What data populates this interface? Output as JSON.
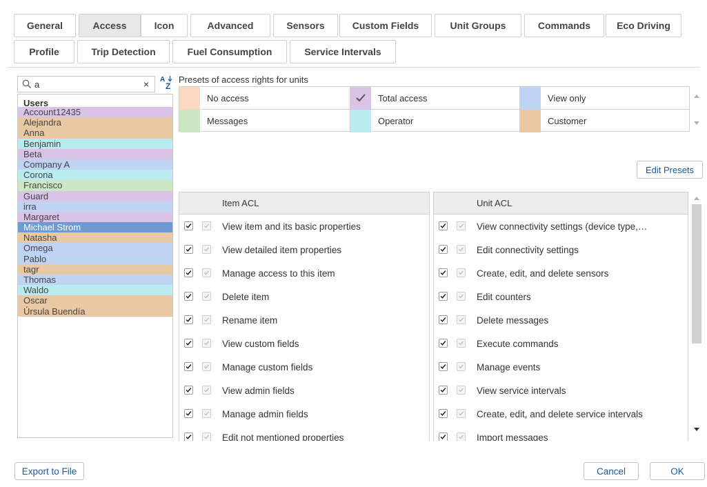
{
  "tabs": [
    {
      "label": "General"
    },
    {
      "label": "Access"
    },
    {
      "label": "Icon"
    },
    {
      "label": "Advanced"
    },
    {
      "label": "Sensors"
    },
    {
      "label": "Custom Fields"
    },
    {
      "label": "Unit Groups"
    },
    {
      "label": "Commands"
    },
    {
      "label": "Eco Driving"
    },
    {
      "label": "Profile"
    },
    {
      "label": "Trip Detection"
    },
    {
      "label": "Fuel Consumption"
    },
    {
      "label": "Service Intervals"
    }
  ],
  "active_tab": "Access",
  "search": {
    "value": "a",
    "icon": "search-icon",
    "clear": "×"
  },
  "users": {
    "header": "Users",
    "items": [
      {
        "name": "Account12435",
        "color": "#d9c3e6"
      },
      {
        "name": "Alejandra",
        "color": "#e9c9a4"
      },
      {
        "name": "Anna",
        "color": "#e9c9a4"
      },
      {
        "name": "Benjamin",
        "color": "#b8ecf0"
      },
      {
        "name": "Beta",
        "color": "#d9c3e6"
      },
      {
        "name": "Company A",
        "color": "#c0d3f2"
      },
      {
        "name": "Corona",
        "color": "#b8ecf0"
      },
      {
        "name": "Francisco",
        "color": "#cde6c4"
      },
      {
        "name": "Guard",
        "color": "#d9c3e6"
      },
      {
        "name": "irra",
        "color": "#c0d3f2"
      },
      {
        "name": "Margaret",
        "color": "#d9c3e6"
      },
      {
        "name": "Michael Strom",
        "color": "#6e9bd1",
        "selected": true
      },
      {
        "name": "Natasha",
        "color": "#e9c9a4"
      },
      {
        "name": "Omega",
        "color": "#c0d3f2"
      },
      {
        "name": "Pablo",
        "color": "#c0d3f2"
      },
      {
        "name": "tagr",
        "color": "#e9c9a4"
      },
      {
        "name": "Thomas",
        "color": "#c0d3f2"
      },
      {
        "name": "Waldo",
        "color": "#b8ecf0"
      },
      {
        "name": "Oscar",
        "color": "#e9c9a4"
      },
      {
        "name": "Úrsula Buendía",
        "color": "#e9c9a4"
      }
    ]
  },
  "presets": {
    "title": "Presets of access rights for units",
    "items": [
      {
        "label": "No access",
        "color": "#fad9c0",
        "checked": false
      },
      {
        "label": "Total access",
        "color": "#d9c3e6",
        "checked": true
      },
      {
        "label": "View only",
        "color": "#c0d3f2",
        "checked": false
      },
      {
        "label": "Messages",
        "color": "#cde6c4",
        "checked": false
      },
      {
        "label": "Operator",
        "color": "#b8ecf0",
        "checked": false
      },
      {
        "label": "Customer",
        "color": "#e9c9a4",
        "checked": false
      }
    ],
    "edit_label": "Edit Presets"
  },
  "item_acl": {
    "header": "Item ACL",
    "rows": [
      "View item and its basic properties",
      "View detailed item properties",
      "Manage access to this item",
      "Delete item",
      "Rename item",
      "View custom fields",
      "Manage custom fields",
      "View admin fields",
      "Manage admin fields",
      "Edit not mentioned properties"
    ]
  },
  "unit_acl": {
    "header": "Unit ACL",
    "rows": [
      "View connectivity settings (device type,…",
      "Edit connectivity settings",
      "Create, edit, and delete sensors",
      "Edit counters",
      "Delete messages",
      "Execute commands",
      "Manage events",
      "View service intervals",
      "Create, edit, and delete service intervals",
      "Import messages"
    ]
  },
  "footer": {
    "export_label": "Export to File",
    "cancel_label": "Cancel",
    "ok_label": "OK"
  },
  "colors": {
    "accent_text": "#1a5a96",
    "selected_user": "#6e9bd1",
    "header_bg": "#ededed"
  }
}
